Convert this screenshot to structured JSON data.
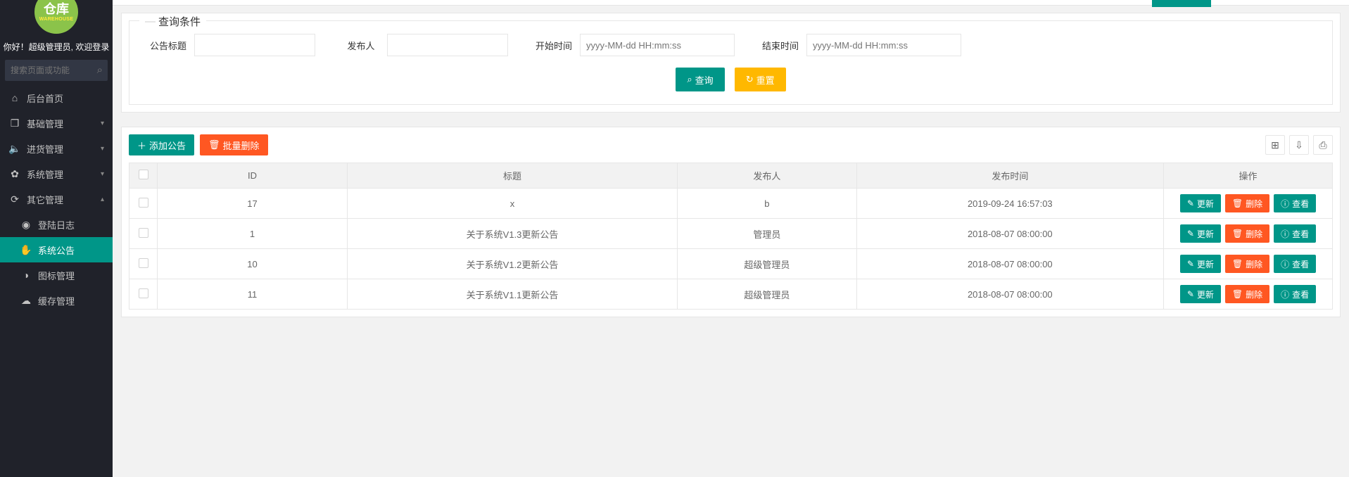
{
  "sidebar": {
    "logo_top": "仓库",
    "logo_sub": "WAREHOUSE",
    "greeting": "你好！超级管理员, 欢迎登录",
    "search_placeholder": "搜索页面或功能",
    "menu": [
      {
        "icon": "⌂",
        "label": "后台首页",
        "arrow": ""
      },
      {
        "icon": "❒",
        "label": "基础管理",
        "arrow": "▾"
      },
      {
        "icon": "🔈",
        "label": "进货管理",
        "arrow": "▾"
      },
      {
        "icon": "✿",
        "label": "系统管理",
        "arrow": "▾"
      },
      {
        "icon": "⟳",
        "label": "其它管理",
        "arrow": "▴"
      }
    ],
    "submenu": [
      {
        "icon": "◉",
        "label": "登陆日志"
      },
      {
        "icon": "✋",
        "label": "系统公告"
      },
      {
        "icon": "◑",
        "label": "图标管理"
      },
      {
        "icon": "☁",
        "label": "缓存管理"
      }
    ]
  },
  "query": {
    "legend": "查询条件",
    "fields": {
      "title_label": "公告标题",
      "publisher_label": "发布人",
      "start_label": "开始时间",
      "start_placeholder": "yyyy-MM-dd HH:mm:ss",
      "end_label": "结束时间",
      "end_placeholder": "yyyy-MM-dd HH:mm:ss"
    },
    "buttons": {
      "search": "查询",
      "reset": "重置"
    }
  },
  "toolbar": {
    "add": "添加公告",
    "batch_delete": "批量删除"
  },
  "table": {
    "headers": {
      "id": "ID",
      "title": "标题",
      "publisher": "发布人",
      "pubtime": "发布时间",
      "ops": "操作"
    },
    "op_labels": {
      "update": "更新",
      "delete": "删除",
      "view": "查看"
    },
    "rows": [
      {
        "id": "17",
        "title": "x",
        "publisher": "b",
        "pubtime": "2019-09-24 16:57:03"
      },
      {
        "id": "1",
        "title": "关于系统V1.3更新公告",
        "publisher": "管理员",
        "pubtime": "2018-08-07 08:00:00"
      },
      {
        "id": "10",
        "title": "关于系统V1.2更新公告",
        "publisher": "超级管理员",
        "pubtime": "2018-08-07 08:00:00"
      },
      {
        "id": "11",
        "title": "关于系统V1.1更新公告",
        "publisher": "超级管理员",
        "pubtime": "2018-08-07 08:00:00"
      }
    ]
  }
}
